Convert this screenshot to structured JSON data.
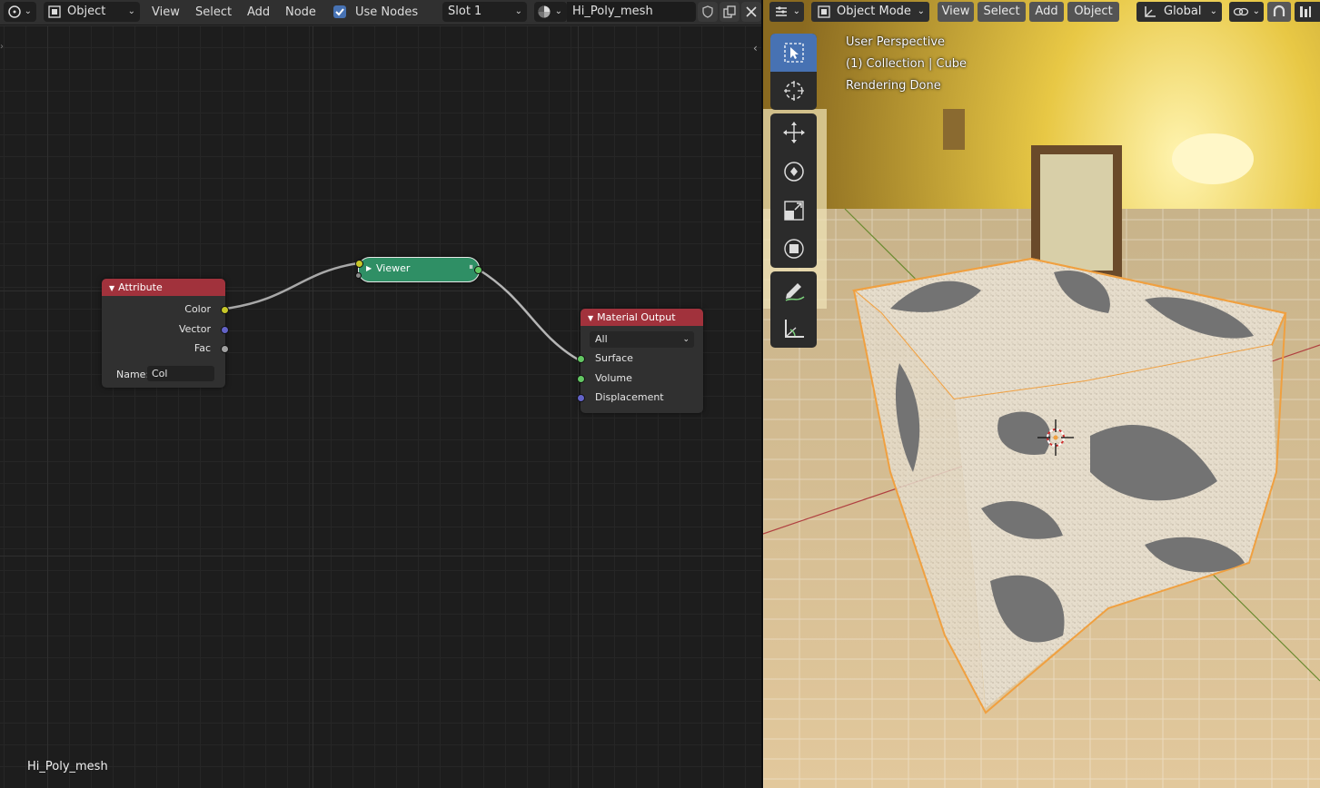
{
  "node_editor": {
    "header": {
      "editor_type_icon": "node-editor-icon",
      "object_selector": "Object",
      "menus": [
        "View",
        "Select",
        "Add",
        "Node"
      ],
      "use_nodes_label": "Use Nodes",
      "use_nodes_checked": true,
      "slot_selector": "Slot 1",
      "material_icon": "material-sphere-icon",
      "material_name": "Hi_Poly_mesh"
    },
    "footer_label": "Hi_Poly_mesh",
    "nodes": {
      "attribute": {
        "title": "Attribute",
        "outputs": [
          "Color",
          "Vector",
          "Fac"
        ],
        "name_label": "Name:",
        "name_value": "Col"
      },
      "viewer": {
        "title": "Viewer"
      },
      "material_output": {
        "title": "Material Output",
        "target": "All",
        "inputs": [
          "Surface",
          "Volume",
          "Displacement"
        ]
      }
    },
    "colors": {
      "attribute_header": "#a1323c",
      "viewer_header": "#2f8f65",
      "output_header": "#a1323c",
      "socket_color": "#c7c729",
      "socket_vector": "#6363c7",
      "socket_float": "#a1a1a1",
      "socket_shader": "#63c763"
    }
  },
  "viewport": {
    "header": {
      "mode": "Object Mode",
      "menus": [
        "View",
        "Select",
        "Add",
        "Object"
      ],
      "orientation": "Global"
    },
    "overlay": {
      "line1": "User Perspective",
      "line2": "(1) Collection | Cube",
      "line3": "Rendering Done"
    },
    "tools": [
      "select-box-icon",
      "cursor-icon",
      "move-icon",
      "rotate-icon",
      "scale-icon",
      "transform-icon",
      "annotate-icon",
      "measure-icon"
    ]
  }
}
